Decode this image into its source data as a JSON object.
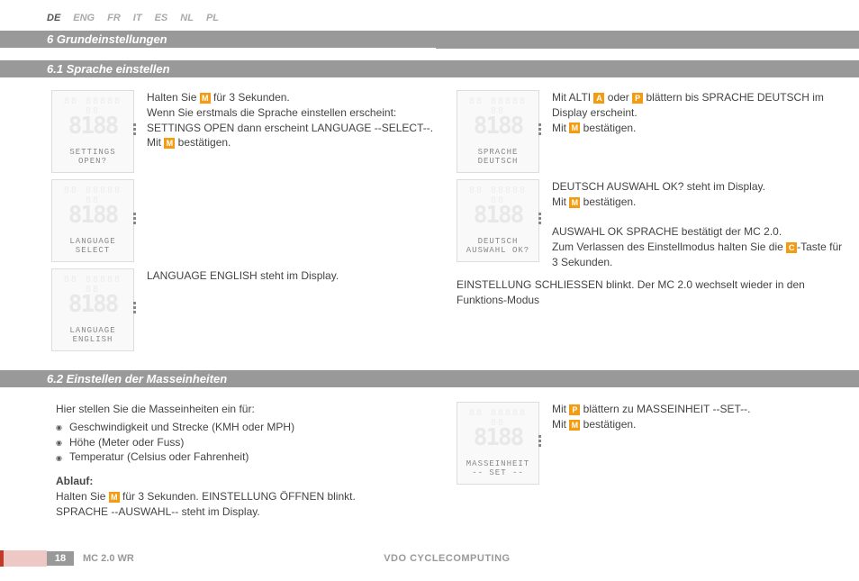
{
  "langs": {
    "de": "DE",
    "eng": "ENG",
    "fr": "FR",
    "it": "IT",
    "es": "ES",
    "nl": "NL",
    "pl": "PL"
  },
  "headings": {
    "h6": "6  Grundeinstellungen",
    "h61": "6.1  Sprache einstellen",
    "h62": "6.2  Einstellen der Masseinheiten"
  },
  "sec61": {
    "left": {
      "p1a": "Halten Sie ",
      "p1b": " für 3 Sekunden.",
      "p1c": "Wenn Sie erstmals die Sprache einstellen erscheint:",
      "p1d": "SETTINGS OPEN dann erscheint LANGUAGE --SELECT--.",
      "p1e": "Mit ",
      "p1f": " bestätigen.",
      "lcd1": "SETTINGS\nOPEN?",
      "lcd2": "LANGUAGE\nSELECT",
      "p2": "LANGUAGE ENGLISH steht im Display.",
      "lcd3": "LANGUAGE\nENGLISH"
    },
    "right": {
      "p1a": "Mit ALTI ",
      "p1b": " oder ",
      "p1c": " blättern bis SPRACHE DEUTSCH im Display erscheint.",
      "p1d": "Mit ",
      "p1e": " bestätigen.",
      "lcd1": "SPRACHE\nDEUTSCH",
      "p2a": "DEUTSCH AUSWAHL OK? steht im Display.",
      "p2b": "Mit ",
      "p2c": " bestätigen.",
      "p3a": "AUSWAHL OK SPRACHE bestätigt der MC 2.0.",
      "p3b": "Zum Verlassen des Einstellmodus halten Sie die ",
      "p3c": "-Taste für 3 Sekunden.",
      "lcd2": "DEUTSCH\nAUSWAHL OK?",
      "p4": "EINSTELLUNG SCHLIESSEN blinkt. Der MC 2.0 wechselt wieder in den Funktions-Modus"
    }
  },
  "sec62": {
    "left": {
      "intro": "Hier stellen Sie die Masseinheiten ein für:",
      "b1": "Geschwindigkeit und Strecke (KMH oder MPH)",
      "b2": "Höhe (Meter oder Fuss)",
      "b3": "Temperatur (Celsius oder Fahrenheit)",
      "ablauf": "Ablauf:",
      "p1a": "Halten Sie ",
      "p1b": " für 3 Sekunden. EINSTELLUNG ÖFFNEN blinkt.",
      "p1c": "SPRACHE --AUSWAHL-- steht im Display."
    },
    "right": {
      "p1a": "Mit ",
      "p1b": " blättern zu MASSEINHEIT --SET--.",
      "p1c": "Mit ",
      "p1d": " bestätigen.",
      "lcd1": "MASSEINHEIT\n-- SET --"
    }
  },
  "buttons": {
    "m": "M",
    "a": "A",
    "p": "P",
    "c": "C"
  },
  "footer": {
    "page": "18",
    "model": "MC 2.0 WR",
    "brand": "VDO CYCLECOMPUTING"
  }
}
